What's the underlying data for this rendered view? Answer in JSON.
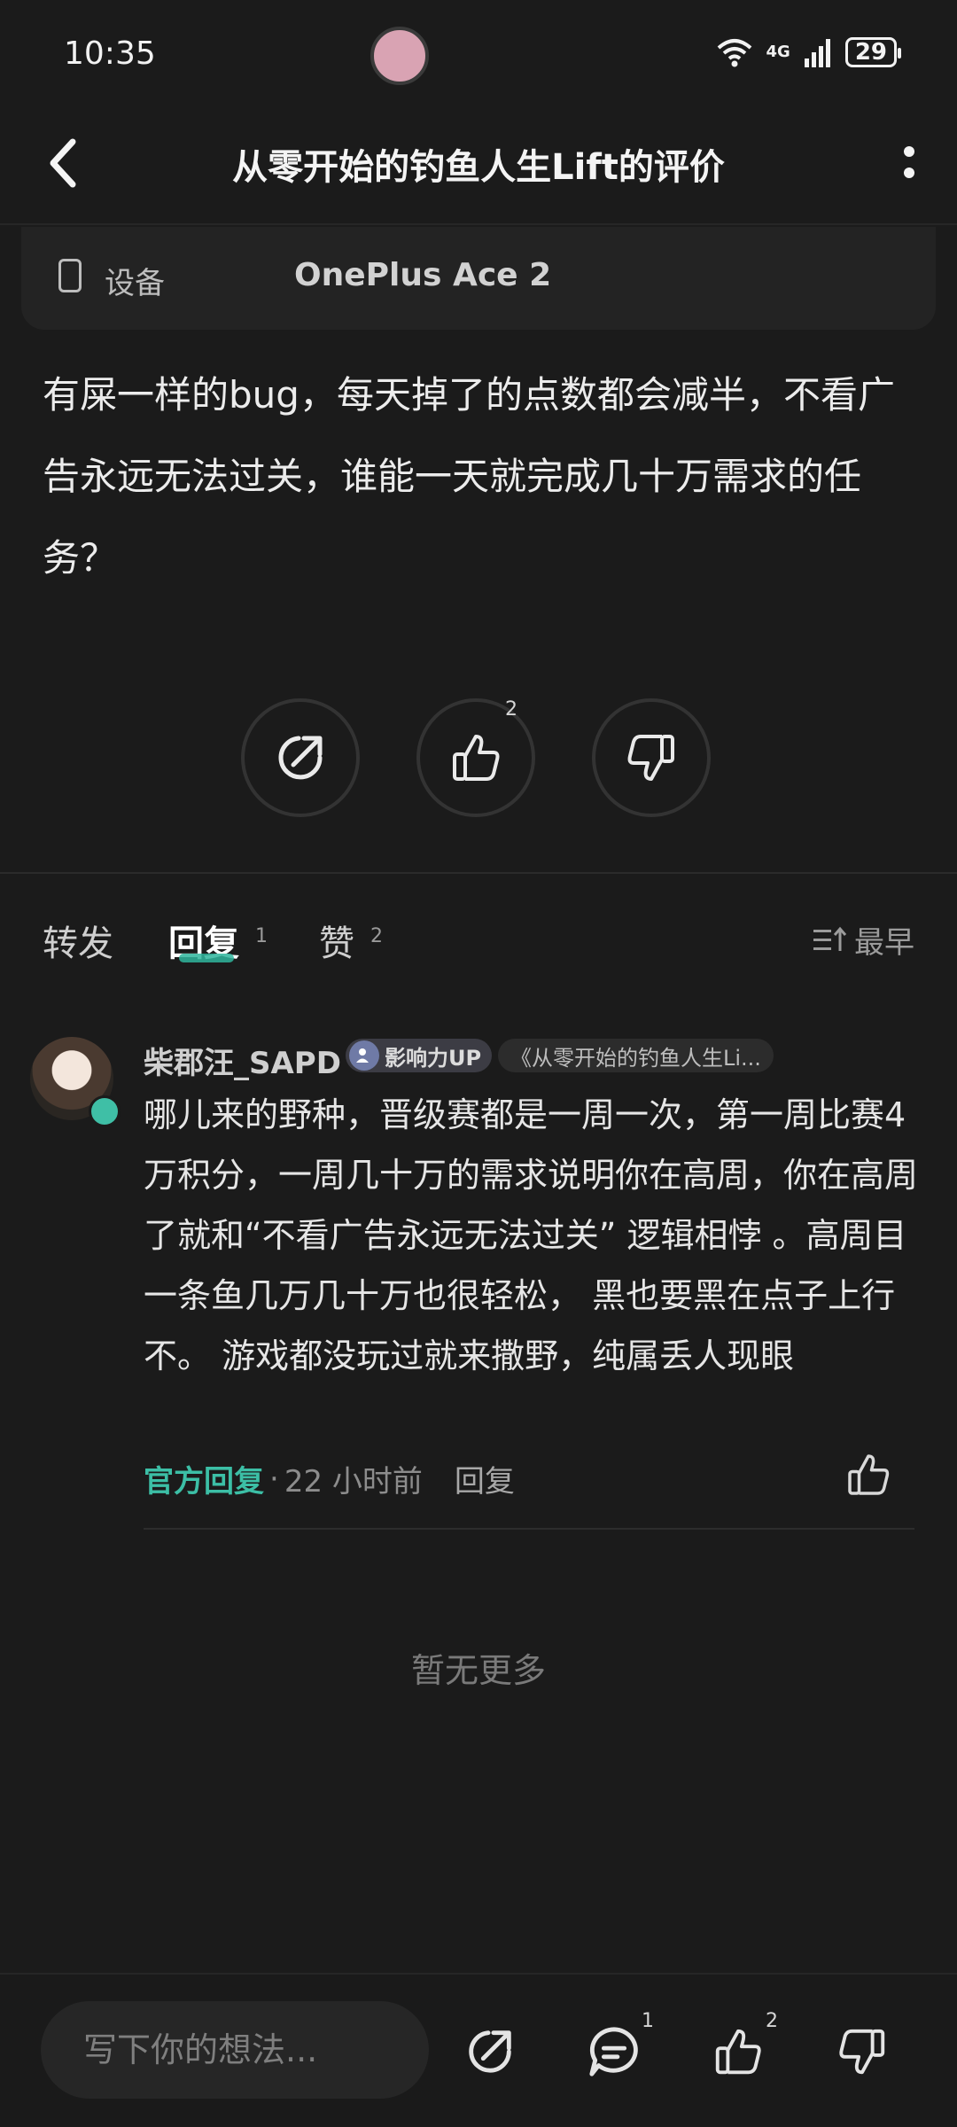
{
  "status_bar": {
    "time": "10:35",
    "network": "4G",
    "battery": "29"
  },
  "header": {
    "title": "从零开始的钓鱼人生Lift的评价"
  },
  "device": {
    "label": "设备",
    "value": "OnePlus Ace 2"
  },
  "review": {
    "text": "有屎一样的bug，每天掉了的点数都会减半，不看广告永远无法过关，谁能一天就完成几十万需求的任务？"
  },
  "actions": {
    "like_count": "2"
  },
  "tabs": [
    {
      "label": "转发",
      "count": ""
    },
    {
      "label": "回复",
      "count": "1"
    },
    {
      "label": "赞",
      "count": "2"
    }
  ],
  "sort": {
    "label": "最早"
  },
  "comment": {
    "username": "柴郡汪_SAPD",
    "tag": "影响力UP",
    "game_tag": "《从零开始的钓鱼人生Li...",
    "text": "哪儿来的野种，晋级赛都是一周一次，第一周比赛4万积分，一周几十万的需求说明你在高周，你在高周了就和“不看广告永远无法过关” 逻辑相悖 。高周目一条鱼几万几十万也很轻松， 黑也要黑在点子上行不。 游戏都没玩过就来撒野，纯属丢人现眼",
    "official_label": "官方回复",
    "dot": "·",
    "time": "22 小时前",
    "reply_label": "回复"
  },
  "footer_text": "暂无更多",
  "bottom_bar": {
    "input_placeholder": "写下你的想法...",
    "comment_count": "1",
    "like_count": "2"
  }
}
